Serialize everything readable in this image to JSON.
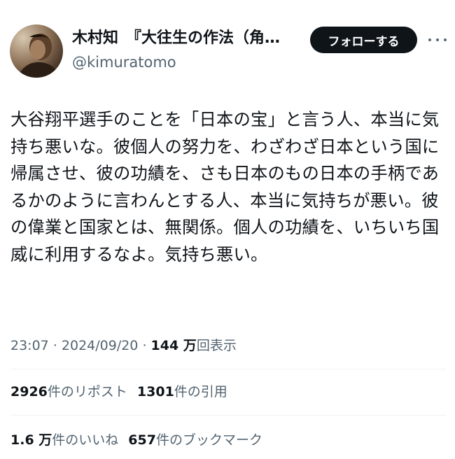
{
  "author": {
    "display_name": "木村知　『大往生の作法（角…",
    "handle": "@kimuratomo",
    "follow_label": "フォローする"
  },
  "tweet": {
    "text": "大谷翔平選手のことを「日本の宝」と言う人、本当に気持ち悪いな。彼個人の努力を、わざわざ日本という国に帰属させ、彼の功績を、さも日本のもの日本の手柄であるかのように言わんとする人、本当に気持ちが悪い。彼の偉業と国家とは、無関係。個人の功績を、いちいち国威に利用するなよ。気持ち悪い。"
  },
  "meta": {
    "time": "23:07",
    "sep1": " · ",
    "date": "2024/09/20",
    "sep2": " · ",
    "views_number": "144 万",
    "views_label": "回表示"
  },
  "stats": {
    "reposts": {
      "number": "2926",
      "label": "件のリポスト"
    },
    "quotes": {
      "number": "1301",
      "label": "件の引用"
    },
    "likes": {
      "number": "1.6 万",
      "label": "件のいいね"
    },
    "bookmarks": {
      "number": "657",
      "label": "件のブックマーク"
    }
  },
  "icons": {
    "more": "more-horizontal-icon"
  }
}
